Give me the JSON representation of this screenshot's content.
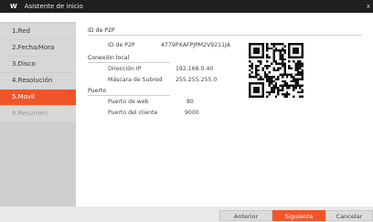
{
  "window": {
    "logo": "W",
    "title": "Asistente de inicio",
    "close": "x"
  },
  "sidebar": {
    "items": [
      {
        "label": "1.Red",
        "state": "normal"
      },
      {
        "label": "2.Fecha/Hora",
        "state": "normal"
      },
      {
        "label": "3.Disco",
        "state": "normal"
      },
      {
        "label": "4.Resolución",
        "state": "normal"
      },
      {
        "label": "5.Movil",
        "state": "active"
      },
      {
        "label": "6.Resumen",
        "state": "disabled"
      }
    ]
  },
  "main": {
    "p2p": {
      "title": "ID de P2P",
      "label": "ID de P2P",
      "value": "4779PXAFPJPM2V9211JA"
    },
    "local": {
      "title": "Conexión local",
      "ip_label": "Dirección IP",
      "ip_value": "192.168.0.40",
      "mask_label": "Máscara de Subred",
      "mask_value": "255.255.255.0"
    },
    "port": {
      "title": "Puerto",
      "web_label": "Puerto de web",
      "web_value": "80",
      "client_label": "Puerto del cliente",
      "client_value": "9000"
    }
  },
  "footer": {
    "prev": "Anterior",
    "next": "Siguiente",
    "cancel": "Cancelar"
  },
  "colors": {
    "accent": "#f0552a",
    "titlebar": "#1f1f1f",
    "sidebar": "#cfcfcf"
  }
}
